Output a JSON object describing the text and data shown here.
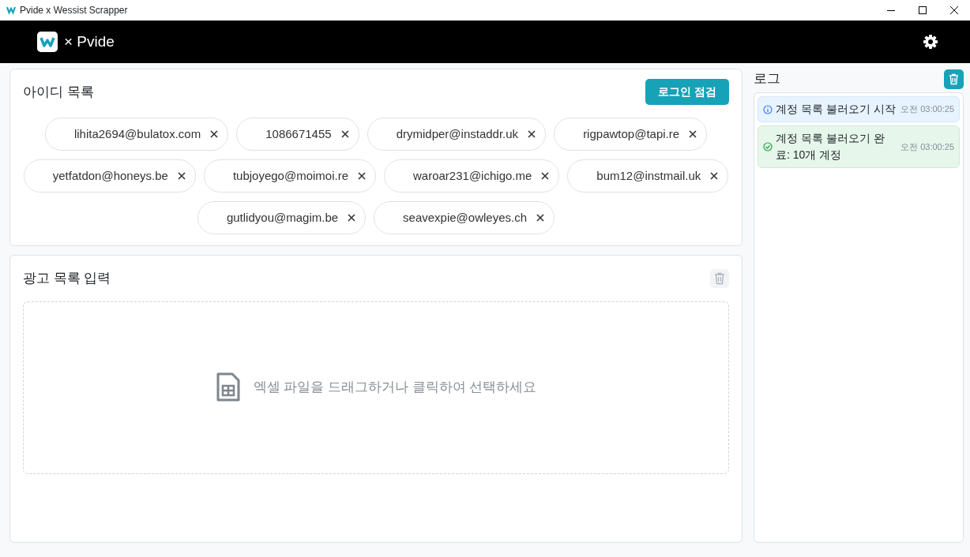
{
  "window": {
    "title": "Pvide x Wessist Scrapper"
  },
  "header": {
    "brand": "× Pvide"
  },
  "accounts": {
    "title": "아이디 목록",
    "check_button": "로그인 점검",
    "ids": [
      {
        "label": "lihita2694@bulatox.com"
      },
      {
        "label": "1086671455"
      },
      {
        "label": "drymidper@instaddr.uk"
      },
      {
        "label": "rigpawtop@tapi.re"
      },
      {
        "label": "yetfatdon@honeys.be"
      },
      {
        "label": "tubjoyego@moimoi.re"
      },
      {
        "label": "waroar231@ichigo.me"
      },
      {
        "label": "bum12@instmail.uk"
      },
      {
        "label": "gutlidyou@magim.be"
      },
      {
        "label": "seavexpie@owleyes.ch"
      }
    ]
  },
  "ads": {
    "title": "광고 목록 입력",
    "dropzone_text": "엑셀 파일을 드래그하거나 클릭하여 선택하세요"
  },
  "log": {
    "title": "로그",
    "entries": [
      {
        "kind": "info",
        "message": "계정 목록 불러오기 시작",
        "time": "오전 03:00:25"
      },
      {
        "kind": "success",
        "message": "계정 목록 불러오기 완료: 10개 계정",
        "time": "오전 03:00:25"
      }
    ]
  }
}
